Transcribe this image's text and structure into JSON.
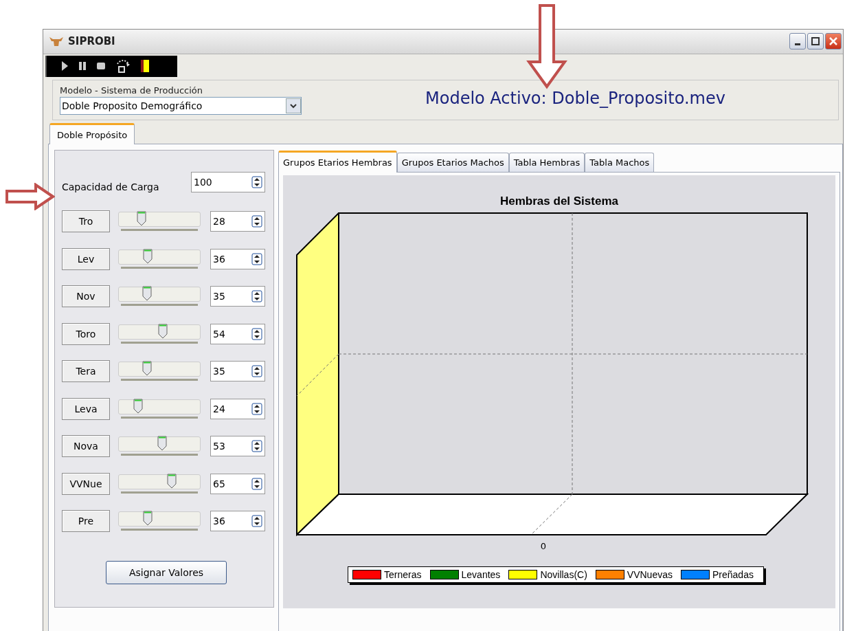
{
  "window": {
    "title": "SIPROBI"
  },
  "model": {
    "label": "Modelo - Sistema de Producción",
    "value": "Doble Proposito Demográfico",
    "active_model": "Modelo Activo: Doble_Proposito.mev"
  },
  "outer_tabs": [
    {
      "label": "Doble Propósito",
      "selected": true
    }
  ],
  "capacity": {
    "label": "Capacidad de Carga",
    "value": "100"
  },
  "sliders": [
    {
      "label": "Tro",
      "level": 0.28,
      "value": "28"
    },
    {
      "label": "Lev",
      "level": 0.36,
      "value": "36"
    },
    {
      "label": "Nov",
      "level": 0.35,
      "value": "35"
    },
    {
      "label": "Toro",
      "level": 0.54,
      "value": "54"
    },
    {
      "label": "Tera",
      "level": 0.35,
      "value": "35"
    },
    {
      "label": "Leva",
      "level": 0.24,
      "value": "24"
    },
    {
      "label": "Nova",
      "level": 0.53,
      "value": "53"
    },
    {
      "label": "VVNue",
      "level": 0.65,
      "value": "65"
    },
    {
      "label": "Pre",
      "level": 0.36,
      "value": "36"
    }
  ],
  "assign_button": "Asignar Valores",
  "inner_tabs": [
    {
      "label": "Grupos Etarios Hembras",
      "selected": true
    },
    {
      "label": "Grupos Etarios Machos",
      "selected": false
    },
    {
      "label": "Tabla Hembras",
      "selected": false
    },
    {
      "label": "Tabla Machos",
      "selected": false
    }
  ],
  "chart": {
    "title": "Hembras del Sistema",
    "x_tick": "0",
    "legend": [
      {
        "label": "Terneras",
        "color": "#ff0000"
      },
      {
        "label": "Levantes",
        "color": "#008000"
      },
      {
        "label": "Novillas(C)",
        "color": "#ffff00"
      },
      {
        "label": "VVNuevas",
        "color": "#ff8000"
      },
      {
        "label": "Preñadas",
        "color": "#0080ff"
      }
    ]
  }
}
